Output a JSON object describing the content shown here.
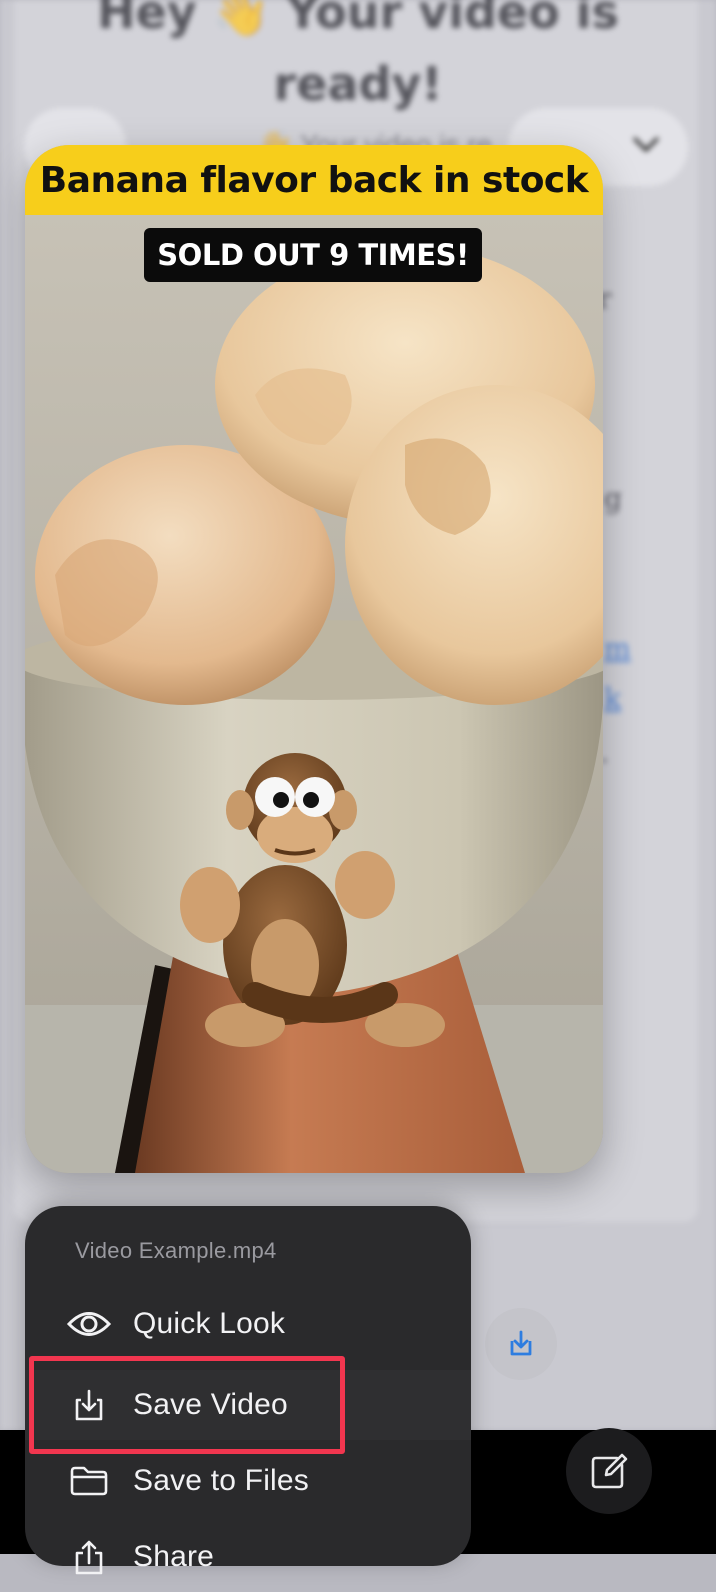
{
  "background_email": {
    "heading": "Hey 👋 Your video is ready!",
    "subline": "👋 Your video is re",
    "fragments": [
      "r",
      "g",
      "m",
      "k",
      "."
    ]
  },
  "video": {
    "caption_title": "Banana flavor back in stock",
    "badge": "SOLD OUT 9 TIMES!"
  },
  "menu": {
    "filename": "Video Example.mp4",
    "items": [
      {
        "label": "Quick Look",
        "icon": "eye-icon"
      },
      {
        "label": "Save Video",
        "icon": "save-download-icon"
      },
      {
        "label": "Save to Files",
        "icon": "folder-icon"
      },
      {
        "label": "Share",
        "icon": "share-icon"
      }
    ]
  },
  "colors": {
    "caption_yellow": "#f7ce1b",
    "highlight_red": "#f2364f",
    "link_blue": "#2d6fd6",
    "menu_bg": "#2a2a2c"
  }
}
